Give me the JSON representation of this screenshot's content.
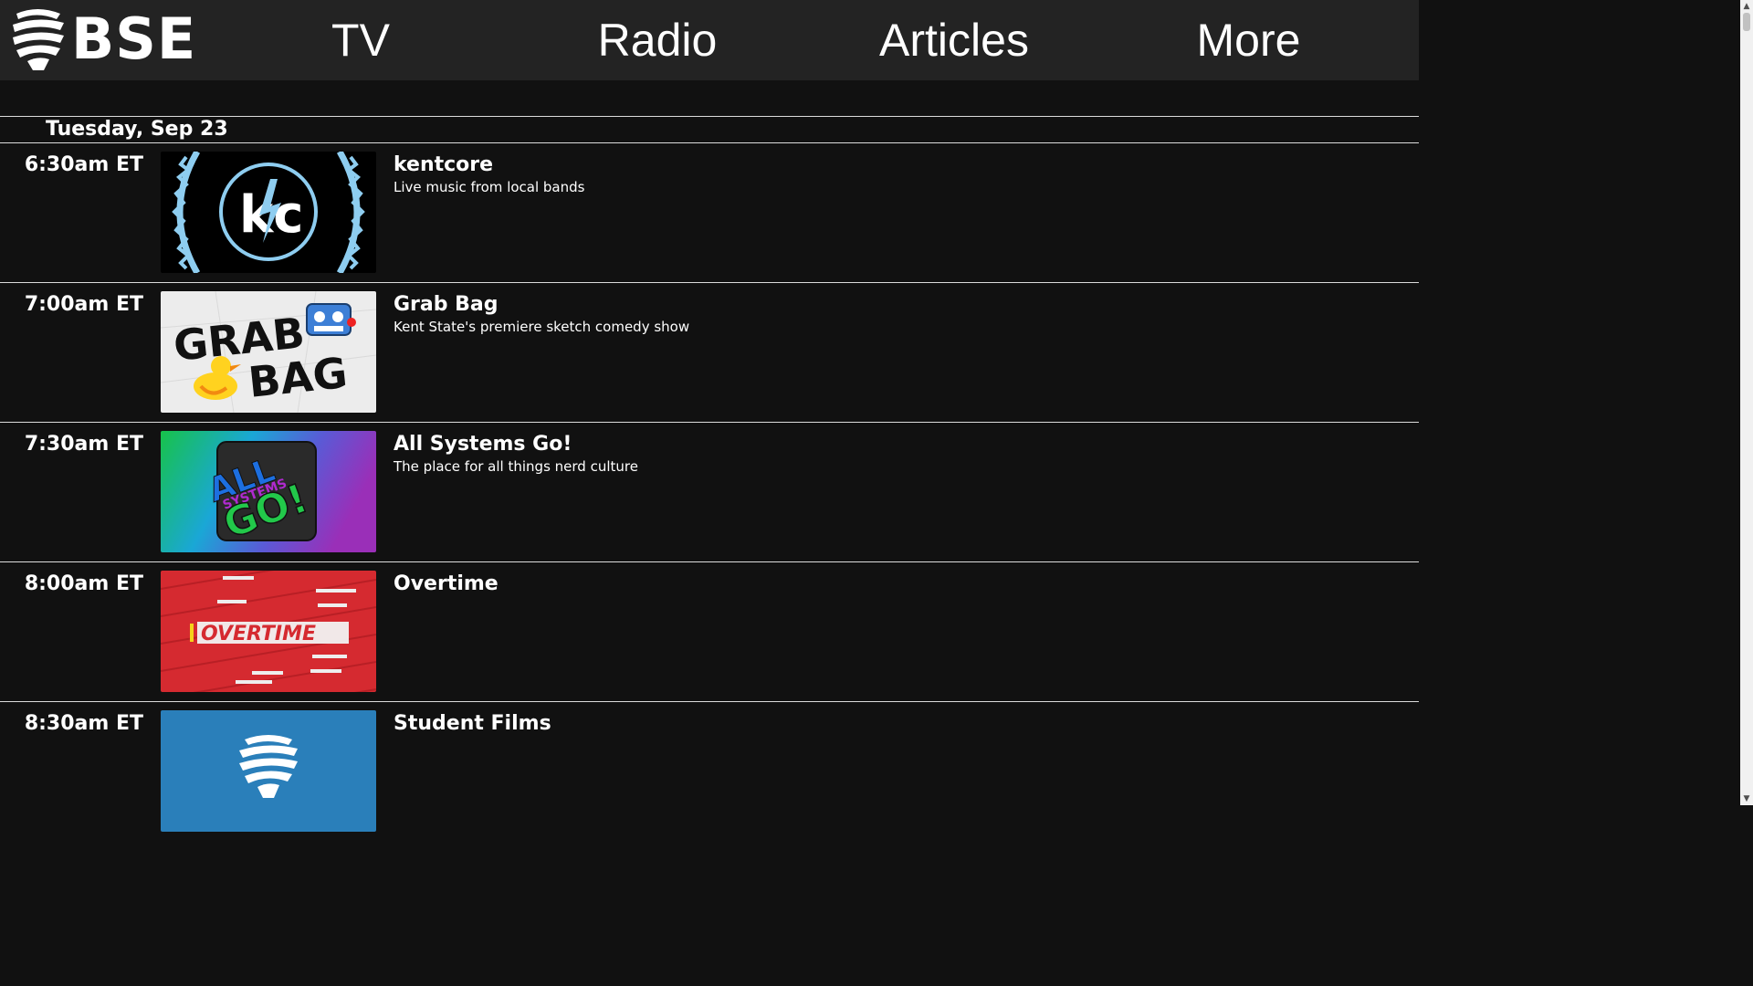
{
  "brand": {
    "logo_icon": "bse-microphone-icon",
    "name": "BSE"
  },
  "nav": {
    "items": [
      {
        "label": "TV"
      },
      {
        "label": "Radio"
      },
      {
        "label": "Articles"
      },
      {
        "label": "More"
      }
    ]
  },
  "schedule": {
    "day": "Tuesday, Sep 23",
    "rows": [
      {
        "time": "6:30am ET",
        "title": "kentcore",
        "description": "Live music from local bands",
        "thumb_icon": "kentcore-logo-icon"
      },
      {
        "time": "7:00am ET",
        "title": "Grab Bag",
        "description": "Kent State's premiere sketch comedy show",
        "thumb_text_1": "GRAB",
        "thumb_text_2": "BAG",
        "thumb_icon": "grab-bag-logo-icon"
      },
      {
        "time": "7:30am ET",
        "title": "All Systems Go!",
        "description": "The place for all things nerd culture",
        "thumb_text_1": "ALL",
        "thumb_text_2": "SYSTEMS",
        "thumb_text_3": "GO!",
        "thumb_icon": "all-systems-go-logo-icon"
      },
      {
        "time": "8:00am ET",
        "title": "Overtime",
        "description": "",
        "thumb_text_1": "OVERTIME",
        "thumb_icon": "overtime-logo-icon"
      },
      {
        "time": "8:30am ET",
        "title": "Student Films",
        "description": "",
        "thumb_icon": "bse-microphone-icon"
      }
    ]
  },
  "colors": {
    "background": "#111111",
    "topbar": "#232323",
    "kentcore_blue": "#8ecdf0",
    "allsystems_green": "#1fb84a",
    "overtime_red": "#d52a30",
    "studentfilms_blue": "#2a7fba"
  }
}
